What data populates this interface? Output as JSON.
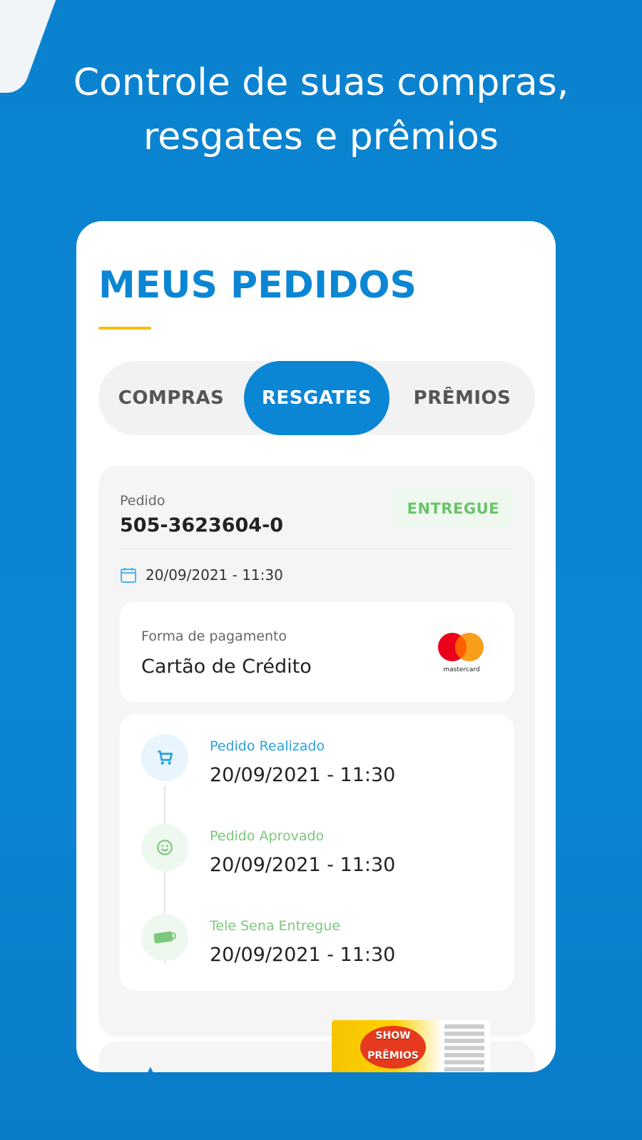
{
  "headline": {
    "line1": "Controle de suas compras,",
    "line2": "resgates e prêmios"
  },
  "page": {
    "title": "MEUS PEDIDOS"
  },
  "tabs": [
    {
      "label": "COMPRAS",
      "active": false
    },
    {
      "label": "RESGATES",
      "active": true
    },
    {
      "label": "PRÊMIOS",
      "active": false
    }
  ],
  "order": {
    "label": "Pedido",
    "number": "505-3623604-0",
    "status": "ENTREGUE",
    "date": "20/09/2021 - 11:30",
    "payment": {
      "label": "Forma de pagamento",
      "value": "Cartão de Crédito",
      "brand": "mastercard"
    },
    "timeline": [
      {
        "label": "Pedido Realizado",
        "date": "20/09/2021 - 11:30",
        "icon": "cart-icon",
        "color": "#29a3e0"
      },
      {
        "label": "Pedido Aprovado",
        "date": "20/09/2021 - 11:30",
        "icon": "smile-icon",
        "color": "#7cc77c"
      },
      {
        "label": "Tele Sena Entregue",
        "date": "20/09/2021 - 11:30",
        "icon": "ticket-icon",
        "color": "#7cc77c"
      }
    ]
  },
  "next_item": {
    "ticket_text": "SHOW PRÊMIOS"
  },
  "colors": {
    "brand_blue": "#0b86d4",
    "accent_yellow": "#f2c200",
    "success_green": "#6bc36b"
  }
}
